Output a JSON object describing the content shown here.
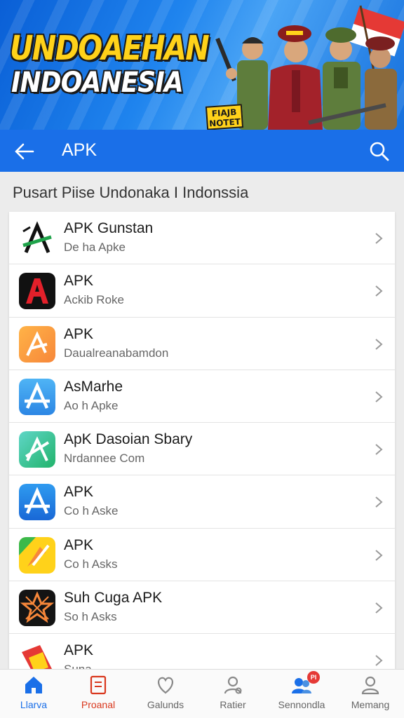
{
  "banner": {
    "title": "UNDOAEHAN",
    "subtitle": "INDOANESIA",
    "badge": "FIAJB NOTET"
  },
  "topbar": {
    "title": "APK",
    "back_icon": "arrow-left-icon",
    "search_icon": "search-icon"
  },
  "section": {
    "title": "Pusart Piise Undonaka I Indonssia"
  },
  "apps": [
    {
      "title": "APK Gunstan",
      "subtitle": "De ha Apke",
      "icon": "green-a-icon"
    },
    {
      "title": "APK",
      "subtitle": "Ackib Roke",
      "icon": "red-a-icon"
    },
    {
      "title": "APK",
      "subtitle": "Daualreanabamdon",
      "icon": "orange-a-icon"
    },
    {
      "title": "AsMarhe",
      "subtitle": "Ao h Apke",
      "icon": "blue-a-icon"
    },
    {
      "title": "ApK Dasoian Sbary",
      "subtitle": "Nrdannee Com",
      "icon": "teal-a-icon"
    },
    {
      "title": "APK",
      "subtitle": "Co h Aske",
      "icon": "blue-a-icon"
    },
    {
      "title": "APK",
      "subtitle": "Co h Asks",
      "icon": "yellow-green-icon"
    },
    {
      "title": "Suh Cuga APK",
      "subtitle": "So h Asks",
      "icon": "orange-star-icon"
    },
    {
      "title": "APK",
      "subtitle": "Suna",
      "icon": "red-yellow-icon"
    }
  ],
  "nav": [
    {
      "label": "Llarva",
      "icon": "home-icon"
    },
    {
      "label": "Proanal",
      "icon": "document-icon"
    },
    {
      "label": "Galunds",
      "icon": "heart-icon"
    },
    {
      "label": "Ratier",
      "icon": "user-icon"
    },
    {
      "label": "Sennondla",
      "icon": "users-icon",
      "badge": "PI"
    },
    {
      "label": "Memang",
      "icon": "profile-icon"
    }
  ],
  "colors": {
    "primary": "#1a6fe8",
    "active_tab": "#d9381e",
    "banner_title": "#ffd21a"
  }
}
